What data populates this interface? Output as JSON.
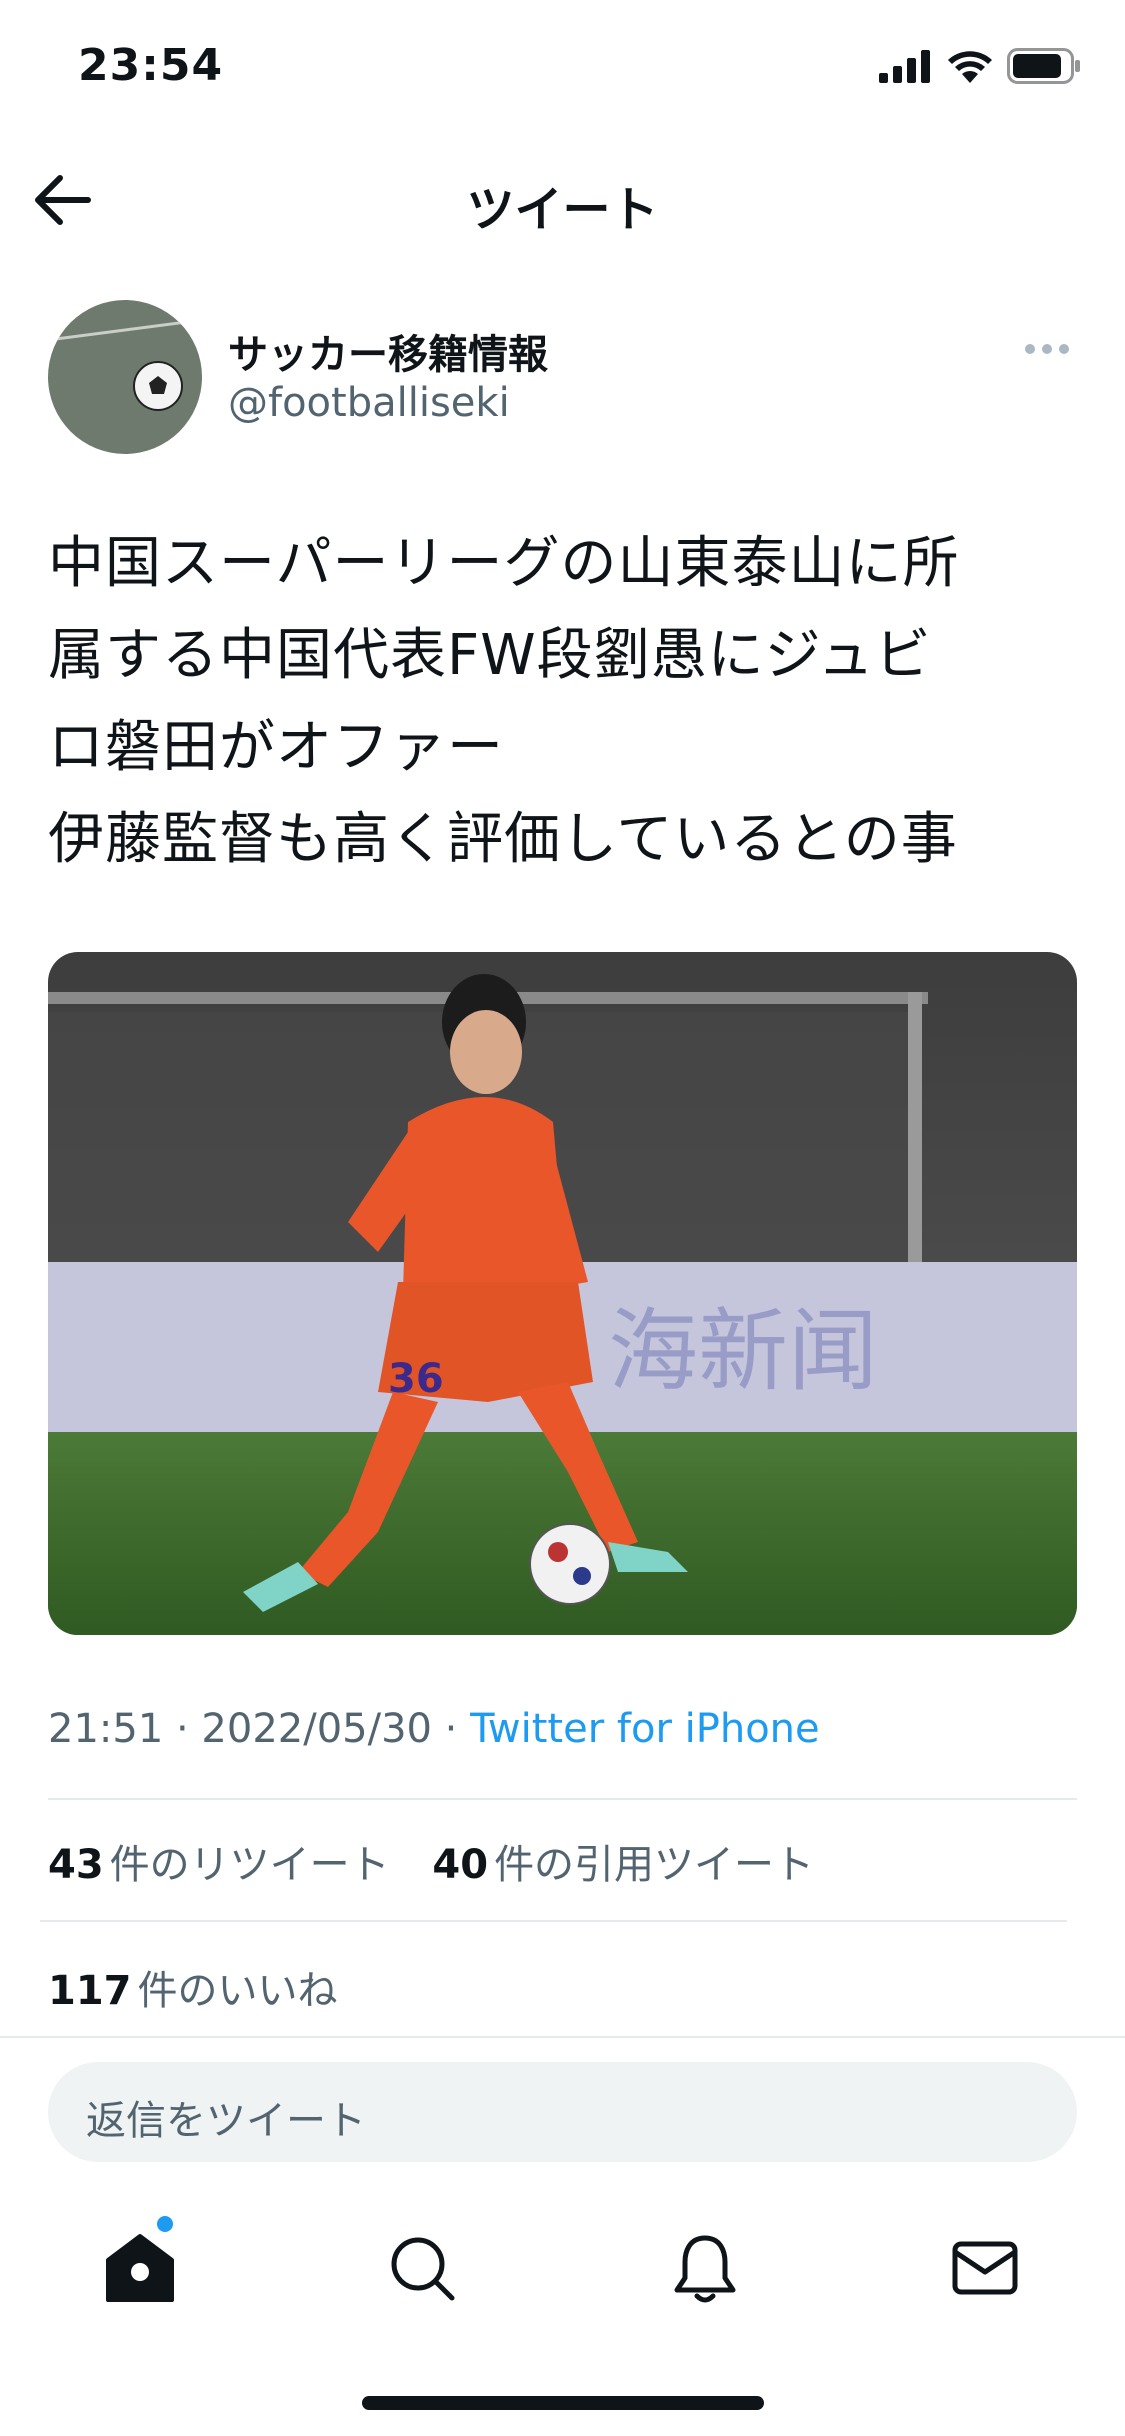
{
  "status_bar": {
    "time": "23:54"
  },
  "nav": {
    "title": "ツイート",
    "back_icon": "back-arrow-icon"
  },
  "author": {
    "name": "サッカー移籍情報",
    "handle": "@footballiseki",
    "avatar_icon": "soccer-ball-avatar"
  },
  "tweet": {
    "text": "中国スーパーリーグの山東泰山に所\n属する中国代表FW段劉愚にジュビ\nロ磐田がオファー\n伊藤監督も高く評価しているとの事",
    "media": {
      "type": "photo",
      "description_icon": "soccer-player-photo"
    }
  },
  "meta": {
    "timestamp": "21:51 · 2022/05/30 · ",
    "source": "Twitter for iPhone"
  },
  "stats": {
    "retweets_count": "43",
    "retweets_label": "件のリツイート",
    "quotes_count": "40",
    "quotes_label": "件の引用ツイート",
    "likes_count": "117",
    "likes_label": "件のいいね"
  },
  "reply": {
    "placeholder": "返信をツイート"
  },
  "tabs": [
    {
      "name": "home",
      "icon": "home-icon"
    },
    {
      "name": "search",
      "icon": "search-icon"
    },
    {
      "name": "notifications",
      "icon": "bell-icon"
    },
    {
      "name": "messages",
      "icon": "mail-icon"
    }
  ],
  "colors": {
    "accent": "#1d9bf0",
    "text": "#0f1419",
    "muted": "#536471",
    "orange_kit": "#e8562a"
  }
}
